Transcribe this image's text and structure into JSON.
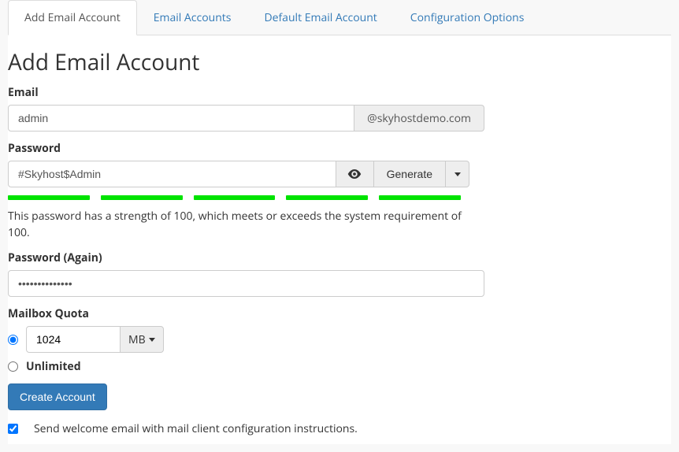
{
  "tabs": [
    {
      "label": "Add Email Account",
      "active": true
    },
    {
      "label": "Email Accounts",
      "active": false
    },
    {
      "label": "Default Email Account",
      "active": false
    },
    {
      "label": "Configuration Options",
      "active": false
    }
  ],
  "page_title": "Add Email Account",
  "email": {
    "label": "Email",
    "value": "admin",
    "domain_suffix": "@skyhostdemo.com"
  },
  "password": {
    "label": "Password",
    "value": "#Skyhost$Admin",
    "generate_label": "Generate",
    "strength_help": "This password has a strength of 100, which meets or exceeds the system requirement of 100."
  },
  "password_again": {
    "label": "Password (Again)",
    "value": "••••••••••••••"
  },
  "quota": {
    "label": "Mailbox Quota",
    "value": "1024",
    "unit": "MB",
    "unlimited_label": "Unlimited",
    "selected": "sized"
  },
  "submit_label": "Create Account",
  "welcome_checkbox": {
    "checked": true,
    "label": "Send welcome email with mail client configuration instructions."
  }
}
